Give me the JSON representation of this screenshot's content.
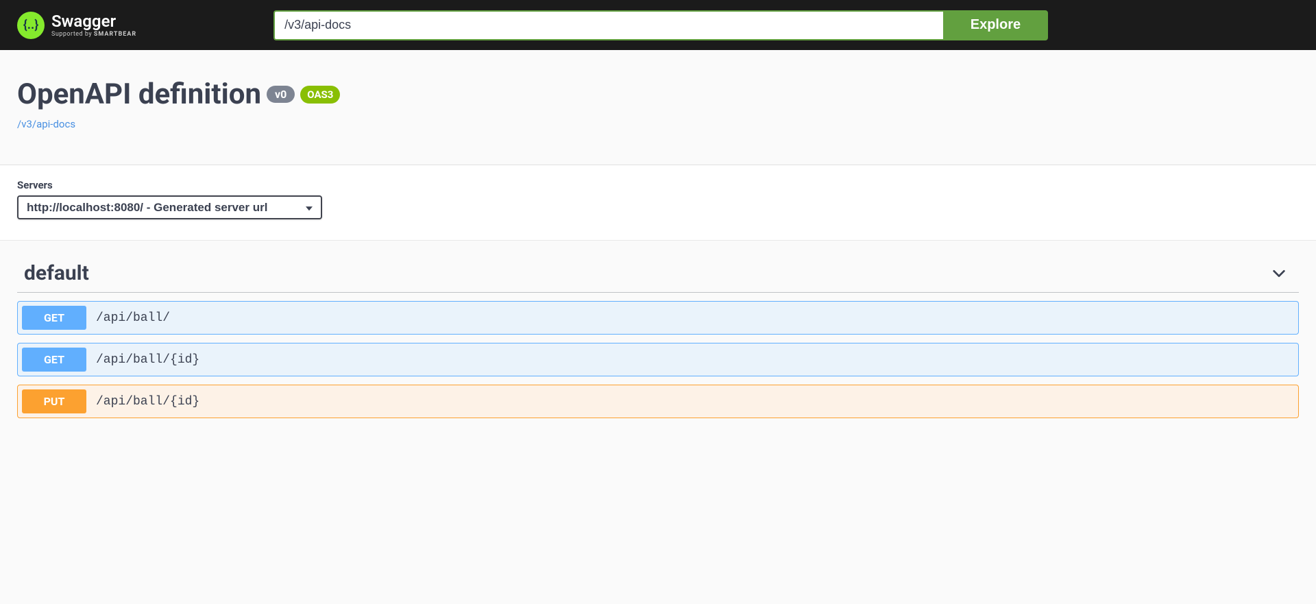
{
  "topbar": {
    "logo_text": "Swagger",
    "logo_sub_prefix": "Supported by ",
    "logo_sub_brand": "SMARTBEAR",
    "search_value": "/v3/api-docs",
    "explore_label": "Explore"
  },
  "info": {
    "title": "OpenAPI definition",
    "version_badge": "v0",
    "oas_badge": "OAS3",
    "docs_link": "/v3/api-docs"
  },
  "servers": {
    "label": "Servers",
    "selected": "http://localhost:8080/ - Generated server url"
  },
  "tag": {
    "name": "default"
  },
  "operations": [
    {
      "method": "GET",
      "method_class": "get",
      "path": "/api/ball/"
    },
    {
      "method": "GET",
      "method_class": "get",
      "path": "/api/ball/{id}"
    },
    {
      "method": "PUT",
      "method_class": "put",
      "path": "/api/ball/{id}"
    }
  ]
}
